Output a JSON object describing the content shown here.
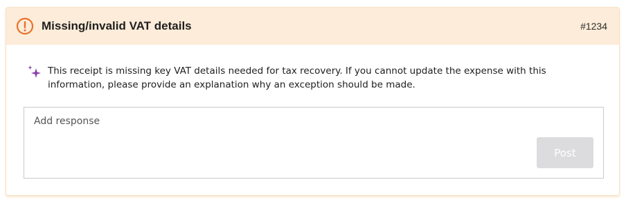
{
  "card": {
    "title": "Missing/invalid VAT details",
    "ref_id": "#1234",
    "icon": "alert-circle-icon",
    "accent_color": "#e8722a",
    "header_bg": "#fdecd9"
  },
  "message": {
    "icon": "sparkle-icon",
    "icon_color": "#8b3fa7",
    "text": "This receipt is missing key VAT details needed for tax recovery. If you cannot update the expense with this information, please provide an explanation why an exception should be made."
  },
  "response": {
    "placeholder": "Add response",
    "value": "",
    "post_label": "Post",
    "post_disabled": true
  }
}
